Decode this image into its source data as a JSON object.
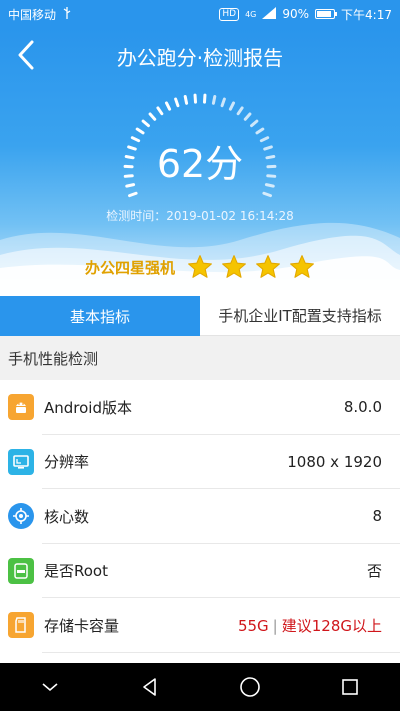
{
  "status_bar": {
    "carrier": "中国移动",
    "usb_icon": "usb-icon",
    "hd_badge": "HD",
    "network": "4G",
    "battery": "90%",
    "battery_level": 0.9,
    "time": "下午4:17"
  },
  "header": {
    "title": "办公跑分·检测报告",
    "score": "62分",
    "time_label": "检测时间：2019-01-02 16:14:28",
    "rating_label": "办公四星强机",
    "stars": 4,
    "colors": {
      "primary": "#2a95ec",
      "star": "#f5c400",
      "warn": "#d0161b"
    }
  },
  "tabs": [
    {
      "label": "基本指标",
      "active": true
    },
    {
      "label": "手机企业IT配置支持指标",
      "active": false
    }
  ],
  "section": {
    "title": "手机性能检测"
  },
  "rows": [
    {
      "icon": "android-icon",
      "label": "Android版本",
      "value": "8.0.0"
    },
    {
      "icon": "resolution-icon",
      "label": "分辨率",
      "value": "1080 x 1920"
    },
    {
      "icon": "cpu-core-icon",
      "label": "核心数",
      "value": "8"
    },
    {
      "icon": "root-icon",
      "label": "是否Root",
      "value": "否"
    },
    {
      "icon": "sd-card-icon",
      "label": "存储卡容量",
      "value": "55G",
      "separator": "|",
      "advice": "建议128G以上"
    }
  ],
  "nav": [
    "collapse-icon",
    "back-triangle-icon",
    "home-circle-icon",
    "recents-square-icon"
  ]
}
